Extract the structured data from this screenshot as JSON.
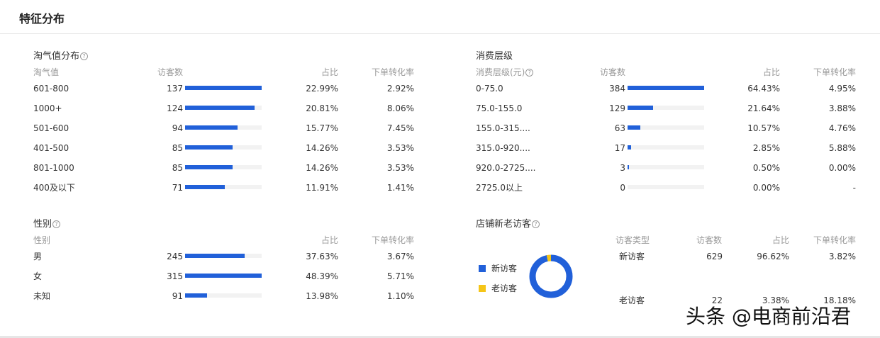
{
  "page": {
    "title": "特征分布",
    "watermark": "头条 @电商前沿君"
  },
  "colors": {
    "bar": "#2160d9",
    "track": "#f2f2f2",
    "new_visitor": "#2160d9",
    "old_visitor": "#f5c518"
  },
  "taoqi": {
    "title": "淘气值分布",
    "headers": {
      "c1": "淘气值",
      "c2": "访客数",
      "c3": "占比",
      "c4": "下单转化率"
    },
    "max": 137,
    "rows": [
      {
        "label": "601-800",
        "count": "137",
        "value": 137,
        "pct": "22.99%",
        "conv": "2.92%"
      },
      {
        "label": "1000+",
        "count": "124",
        "value": 124,
        "pct": "20.81%",
        "conv": "8.06%"
      },
      {
        "label": "501-600",
        "count": "94",
        "value": 94,
        "pct": "15.77%",
        "conv": "7.45%"
      },
      {
        "label": "401-500",
        "count": "85",
        "value": 85,
        "pct": "14.26%",
        "conv": "3.53%"
      },
      {
        "label": "801-1000",
        "count": "85",
        "value": 85,
        "pct": "14.26%",
        "conv": "3.53%"
      },
      {
        "label": "400及以下",
        "count": "71",
        "value": 71,
        "pct": "11.91%",
        "conv": "1.41%"
      }
    ]
  },
  "spend": {
    "title": "消费层级",
    "headers": {
      "c1": "消费层级(元)",
      "c2": "访客数",
      "c3": "占比",
      "c4": "下单转化率"
    },
    "max": 384,
    "rows": [
      {
        "label": "0-75.0",
        "count": "384",
        "value": 384,
        "pct": "64.43%",
        "conv": "4.95%"
      },
      {
        "label": "75.0-155.0",
        "count": "129",
        "value": 129,
        "pct": "21.64%",
        "conv": "3.88%"
      },
      {
        "label": "155.0-315....",
        "count": "63",
        "value": 63,
        "pct": "10.57%",
        "conv": "4.76%"
      },
      {
        "label": "315.0-920....",
        "count": "17",
        "value": 17,
        "pct": "2.85%",
        "conv": "5.88%"
      },
      {
        "label": "920.0-2725....",
        "count": "3",
        "value": 3,
        "pct": "0.50%",
        "conv": "0.00%"
      },
      {
        "label": "2725.0以上",
        "count": "0",
        "value": 0,
        "pct": "0.00%",
        "conv": "-"
      }
    ]
  },
  "gender": {
    "title": "性别",
    "headers": {
      "c1": "性别",
      "c3": "占比",
      "c4": "下单转化率"
    },
    "max": 315,
    "rows": [
      {
        "label": "男",
        "count": "245",
        "value": 245,
        "pct": "37.63%",
        "conv": "3.67%"
      },
      {
        "label": "女",
        "count": "315",
        "value": 315,
        "pct": "48.39%",
        "conv": "5.71%"
      },
      {
        "label": "未知",
        "count": "91",
        "value": 91,
        "pct": "13.98%",
        "conv": "1.10%"
      }
    ]
  },
  "visitors": {
    "title": "店铺新老访客",
    "legend": {
      "new": "新访客",
      "old": "老访客"
    },
    "headers": {
      "c1": "访客类型",
      "c2": "访客数",
      "c3": "占比",
      "c4": "下单转化率"
    },
    "rows": [
      {
        "label": "新访客",
        "count": "629",
        "value": 629,
        "pct": "96.62%",
        "conv": "3.82%"
      },
      {
        "label": "老访客",
        "count": "22",
        "value": 22,
        "pct": "3.38%",
        "conv": "18.18%"
      }
    ]
  }
}
